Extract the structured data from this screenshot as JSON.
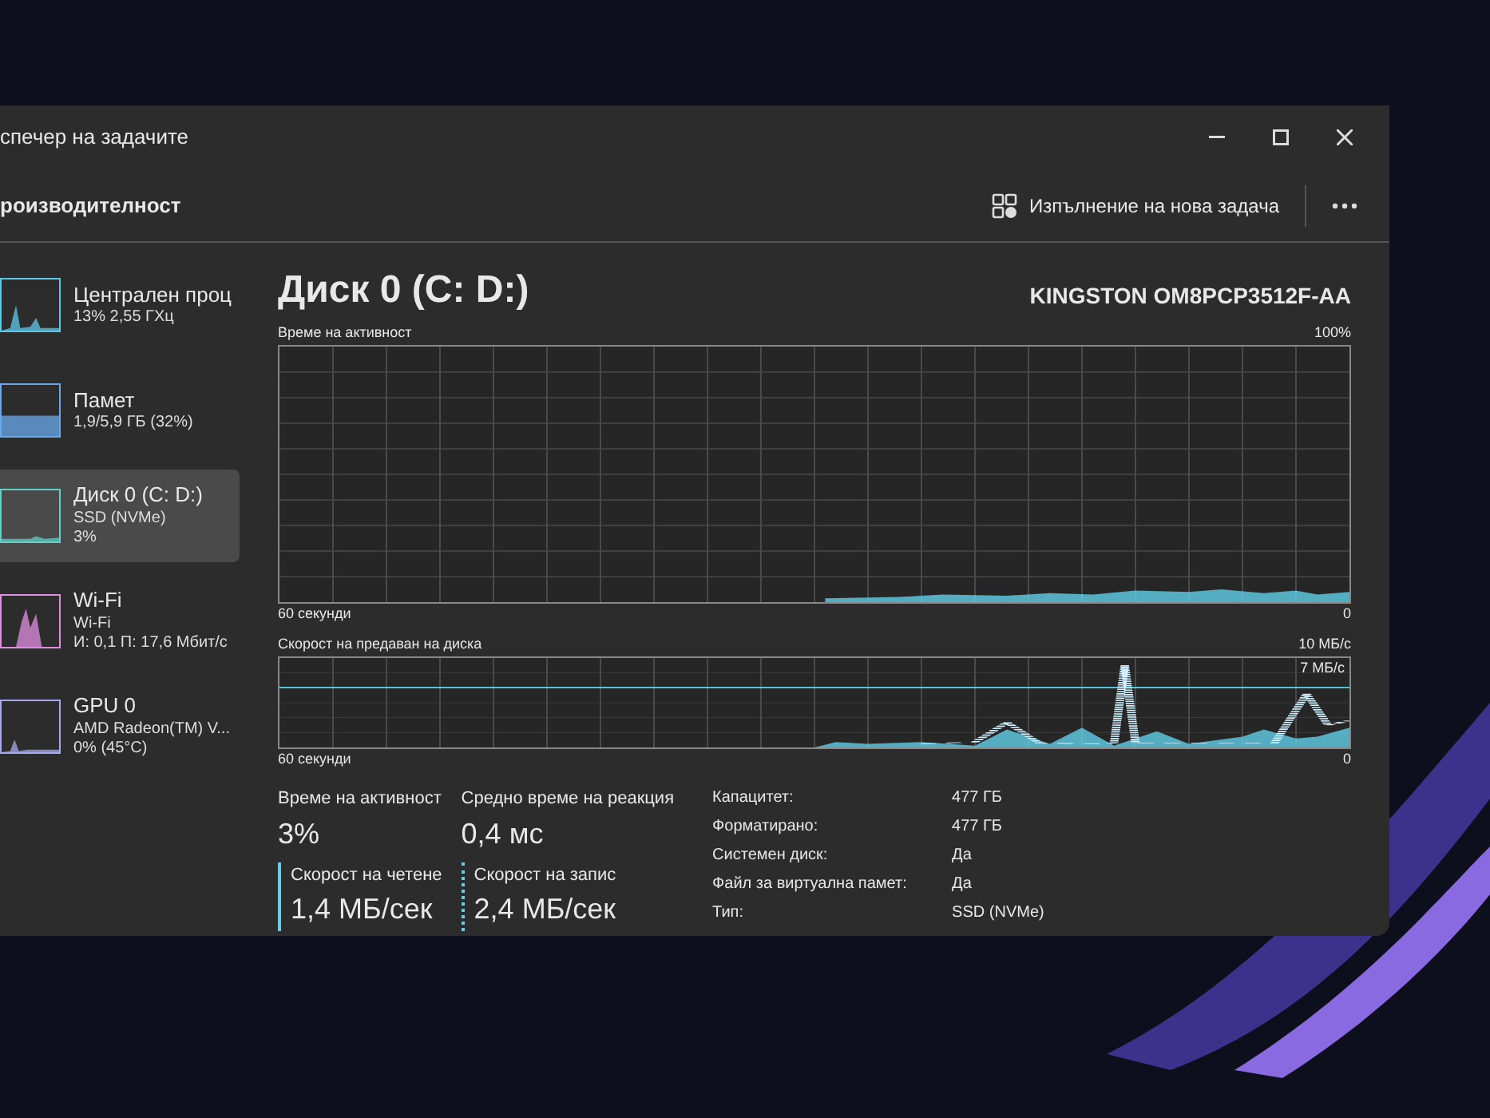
{
  "window": {
    "title": "спечер на задачите"
  },
  "toolbar": {
    "page_title": "роизводителност",
    "run_task": "Изпълнение на нова задача"
  },
  "sidebar": {
    "items": [
      {
        "name": "Централен проц",
        "details": [
          "13% 2,55 ГХц"
        ],
        "color": "#5cc8e8",
        "selected": false
      },
      {
        "name": "Памет",
        "details": [
          "1,9/5,9 ГБ (32%)"
        ],
        "color": "#6aa8ec",
        "selected": false
      },
      {
        "name": "Диск 0 (C: D:)",
        "details": [
          "SSD (NVMe)",
          "3%"
        ],
        "color": "#62d0c8",
        "selected": true
      },
      {
        "name": "Wi-Fi",
        "details": [
          "Wi-Fi",
          "И: 0,1 П: 17,6 Мбит/с"
        ],
        "color": "#e08ee0",
        "selected": false
      },
      {
        "name": "GPU 0",
        "details": [
          "AMD Radeon(TM) V...",
          "0% (45°C)"
        ],
        "color": "#a8a8f0",
        "selected": false
      }
    ]
  },
  "main": {
    "title": "Диск 0 (C: D:)",
    "model": "KINGSTON OM8PCP3512F-AA",
    "activity_graph": {
      "label": "Време на активност",
      "max": "100%",
      "time": "60 секунди",
      "min": "0"
    },
    "transfer_graph": {
      "label": "Скорост на предаван на диска",
      "max": "10 МБ/с",
      "line_label": "7 МБ/с",
      "time": "60 секунди",
      "min": "0"
    },
    "stats": [
      {
        "kind": "plain",
        "label": "Време на активност",
        "value": "3%"
      },
      {
        "kind": "plain",
        "label": "Средно време на реакция",
        "value": "0,4 мс"
      },
      {
        "kind": "read",
        "label": "Скорост на четене",
        "value": "1,4 МБ/сек"
      },
      {
        "kind": "write",
        "label": "Скорост на запис",
        "value": "2,4 МБ/сек"
      }
    ],
    "properties": [
      {
        "label": "Капацитет:",
        "value": "477 ГБ"
      },
      {
        "label": "Форматирано:",
        "value": "477 ГБ"
      },
      {
        "label": "Системен диск:",
        "value": "Да"
      },
      {
        "label": "Файл за виртуална памет:",
        "value": "Да"
      },
      {
        "label": "Тип:",
        "value": "SSD (NVMe)"
      }
    ]
  }
}
